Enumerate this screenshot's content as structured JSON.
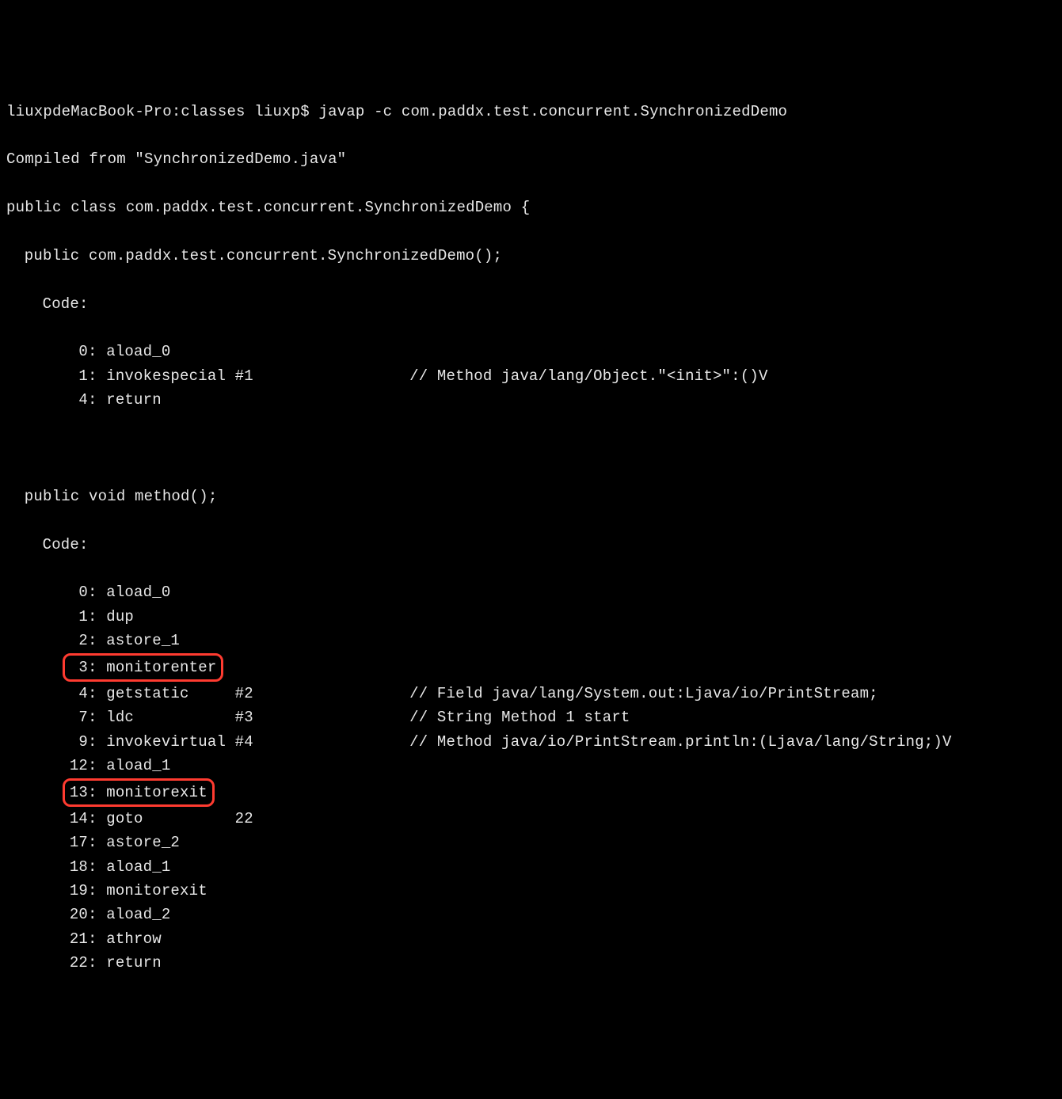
{
  "prompt": {
    "host": "liuxpdeMacBook-Pro:classes liuxp$ ",
    "command": "javap -c com.paddx.test.concurrent.SynchronizedDemo"
  },
  "compiled_from": "Compiled from \"SynchronizedDemo.java\"",
  "class_decl": "public class com.paddx.test.concurrent.SynchronizedDemo {",
  "constructor": {
    "signature": "public com.paddx.test.concurrent.SynchronizedDemo();",
    "code_label": "Code:",
    "instructions": [
      {
        "pc": " 0:",
        "op": "aload_0",
        "arg": "",
        "comment": ""
      },
      {
        "pc": " 1:",
        "op": "invokespecial",
        "arg": "#1",
        "comment": "// Method java/lang/Object.\"<init>\":()V"
      },
      {
        "pc": " 4:",
        "op": "return",
        "arg": "",
        "comment": ""
      }
    ]
  },
  "method": {
    "signature": "public void method();",
    "code_label": "Code:",
    "instructions": [
      {
        "pc": " 0:",
        "op": "aload_0",
        "arg": "",
        "comment": "",
        "highlight": false
      },
      {
        "pc": " 1:",
        "op": "dup",
        "arg": "",
        "comment": "",
        "highlight": false
      },
      {
        "pc": " 2:",
        "op": "astore_1",
        "arg": "",
        "comment": "",
        "highlight": false
      },
      {
        "pc": " 3:",
        "op": "monitorenter",
        "arg": "",
        "comment": "",
        "highlight": true
      },
      {
        "pc": " 4:",
        "op": "getstatic",
        "arg": "#2",
        "comment": "// Field java/lang/System.out:Ljava/io/PrintStream;",
        "highlight": false
      },
      {
        "pc": " 7:",
        "op": "ldc",
        "arg": "#3",
        "comment": "// String Method 1 start",
        "highlight": false
      },
      {
        "pc": " 9:",
        "op": "invokevirtual",
        "arg": "#4",
        "comment": "// Method java/io/PrintStream.println:(Ljava/lang/String;)V",
        "highlight": false
      },
      {
        "pc": "12:",
        "op": "aload_1",
        "arg": "",
        "comment": "",
        "highlight": false
      },
      {
        "pc": "13:",
        "op": "monitorexit",
        "arg": "",
        "comment": "",
        "highlight": true
      },
      {
        "pc": "14:",
        "op": "goto",
        "arg": "22",
        "comment": "",
        "highlight": false
      },
      {
        "pc": "17:",
        "op": "astore_2",
        "arg": "",
        "comment": "",
        "highlight": false
      },
      {
        "pc": "18:",
        "op": "aload_1",
        "arg": "",
        "comment": "",
        "highlight": false
      },
      {
        "pc": "19:",
        "op": "monitorexit",
        "arg": "",
        "comment": "",
        "highlight": false
      },
      {
        "pc": "20:",
        "op": "aload_2",
        "arg": "",
        "comment": "",
        "highlight": false
      },
      {
        "pc": "21:",
        "op": "athrow",
        "arg": "",
        "comment": "",
        "highlight": false
      },
      {
        "pc": "22:",
        "op": "return",
        "arg": "",
        "comment": "",
        "highlight": false
      }
    ]
  }
}
